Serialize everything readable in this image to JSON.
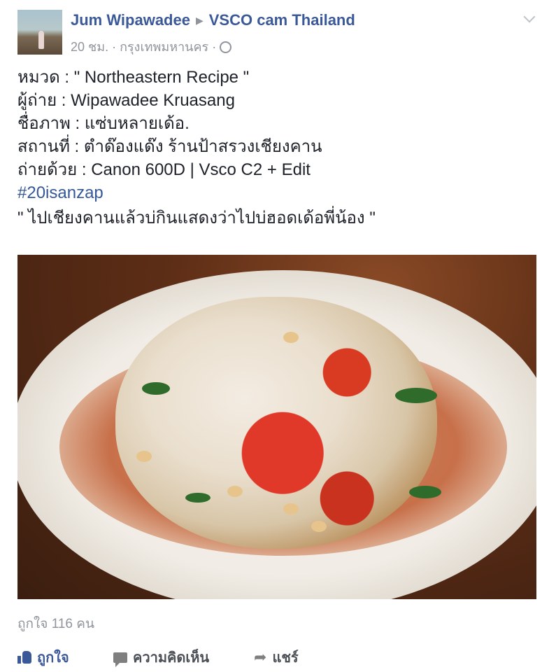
{
  "post": {
    "author": "Jum Wipawadee",
    "group": "VSCO cam Thailand",
    "time": "20 ชม.",
    "location": "กรุงเทพมหานคร",
    "body_lines": [
      "หมวด : \" Northeastern Recipe \"",
      "ผู้ถ่าย : Wipawadee Kruasang",
      "ชื่อภาพ : แซ่บหลายเด้อ.",
      "สถานที่ : ตำด๊องแด๊ง ร้านป้าสรวงเชียงคาน",
      "ถ่ายด้วย : Canon 600D | Vsco C2 + Edit"
    ],
    "hashtag": "#20isanzap",
    "quote": "\" ไปเชียงคานแล้วบ่กินแสดงว่าไปบ่ฮอดเด้อพี่น้อง \"",
    "likes": "ถูกใจ 116 คน"
  },
  "actions": {
    "like": "ถูกใจ",
    "comment": "ความคิดเห็น",
    "share": "แชร์"
  },
  "icons": {
    "arrow": "triangle-right-icon",
    "privacy": "globe-icon",
    "menu": "chevron-down-icon"
  },
  "colors": {
    "link": "#3b5998",
    "meta": "#90949c",
    "text": "#1d2129"
  }
}
